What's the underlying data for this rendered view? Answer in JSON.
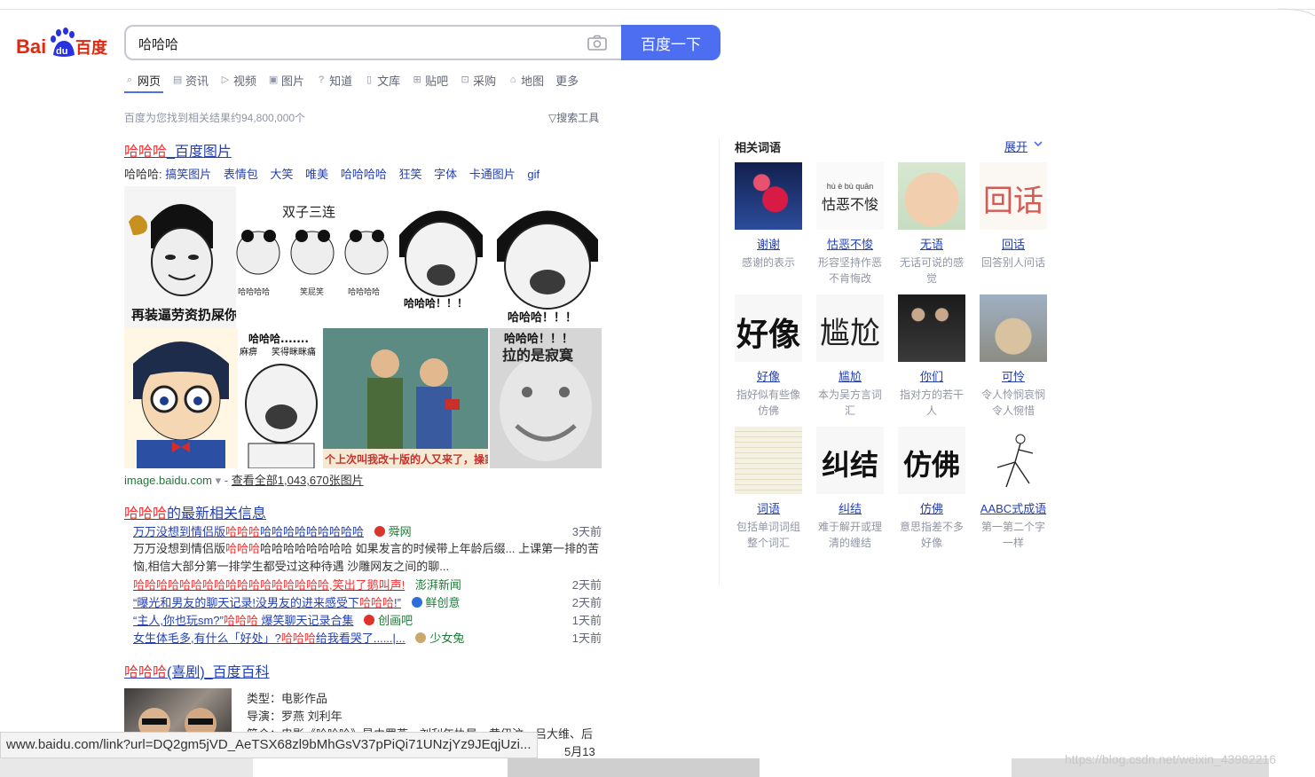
{
  "logo": {
    "text_bai": "Bai",
    "text_du": "du",
    "text_cn": "百度"
  },
  "search": {
    "value": "哈哈哈",
    "button": "百度一下"
  },
  "tabs": [
    {
      "label": "网页",
      "icon": "search-icon"
    },
    {
      "label": "资讯",
      "icon": "news-icon"
    },
    {
      "label": "视频",
      "icon": "video-icon"
    },
    {
      "label": "图片",
      "icon": "image-icon"
    },
    {
      "label": "知道",
      "icon": "question-icon"
    },
    {
      "label": "文库",
      "icon": "doc-icon"
    },
    {
      "label": "贴吧",
      "icon": "tieba-icon"
    },
    {
      "label": "采购",
      "icon": "cart-icon"
    },
    {
      "label": "地图",
      "icon": "map-icon"
    },
    {
      "label": "更多",
      "icon": ""
    }
  ],
  "result_count": "百度为您找到相关结果约94,800,000个",
  "search_tools": "搜索工具",
  "image_result": {
    "title_hl": "哈哈哈",
    "title_rest": "_百度图片",
    "tags_prefix": "哈哈哈:",
    "tags": [
      "搞笑图片",
      "表情包",
      "大笑",
      "唯美",
      "哈哈哈哈",
      "狂笑",
      "字体",
      "卡通图片",
      "gif"
    ],
    "images": [
      {
        "caption": "再装逼劳资扔屎你"
      },
      {
        "caption": "双子三连",
        "labels": [
          "哈哈哈哈",
          "笑屁笑",
          "哈哈哈哈"
        ]
      },
      {
        "caption": "哈哈哈！！！"
      },
      {
        "caption": "哈哈哈！！！"
      },
      {
        "caption": ""
      },
      {
        "caption": "哈哈哈.......",
        "sub1": "麻痹",
        "sub2": "笑得眯眯痛"
      },
      {
        "caption": "个上次叫我改十版的人又来了，操家"
      },
      {
        "caption": "拉的是寂寞"
      }
    ],
    "source": "image.baidu.com",
    "source_arrow": "▾",
    "dash": "-",
    "view_all": "查看全部1,043,670张图片"
  },
  "news_result": {
    "title_hl": "哈哈哈",
    "title_rest": "的最新相关信息",
    "items": [
      {
        "title_pre": "万万没想到情侣版",
        "title_hl": "哈哈哈",
        "title_post": "哈哈哈哈哈哈哈哈哈",
        "source": "舜网",
        "date": "3天前",
        "badge_color": "#d9362b"
      },
      {
        "title_pre": "",
        "title_hl": "哈哈哈",
        "title_post": "哈哈哈哈哈哈哈哈哈哈哈哈哈哈,笑出了鹅叫声!",
        "source": "澎湃新闻",
        "date": "2天前",
        "badge_color": ""
      },
      {
        "title_pre": "“曝光和男友的聊天记录!没男友的进来感受下",
        "title_hl": "哈哈哈",
        "title_post": "!”",
        "source": "鲜创意",
        "date": "2天前",
        "badge_color": "#2d6fd6"
      },
      {
        "title_pre": "“主人,你也玩sm?”",
        "title_hl": "哈哈哈",
        "title_post": " 爆笑聊天记录合集",
        "source": "创画吧",
        "date": "1天前",
        "badge_color": "#e0312a"
      },
      {
        "title_pre": "女生体毛多,有什么「好处」?",
        "title_hl": "哈哈哈",
        "title_post": "给我看哭了......|...",
        "source": "少女兔",
        "date": "1天前",
        "badge_color": "#c9a96b"
      }
    ],
    "abstract_1": "万万没想到情侣版",
    "abstract_hl": "哈哈哈",
    "abstract_2": "哈哈哈哈哈哈哈哈 如果发言的时候带上年龄后缀... 上课第一排的苦恼,相信大部分第一排学生都受过这种待遇 沙雕网友之间的聊..."
  },
  "baike_result": {
    "title_hl": "哈哈哈",
    "title_rest": "(喜剧)_百度百科",
    "type": "类型：电影作品",
    "director": "导演：罗燕 刘利年",
    "intro": "简介：电影《哈哈哈》是由罗燕、刘利年执导，黄伊汶、吕大维、后",
    "date_tail": "5月13"
  },
  "related": {
    "heading": "相关词语",
    "expand": "展开",
    "items": [
      {
        "name": "谢谢",
        "desc": "感谢的表示",
        "thumb_text": "",
        "thumb_kind": "flower"
      },
      {
        "name": "怙恶不悛",
        "desc": "形容坚持作恶不肯悔改",
        "thumb_text": "怙恶不悛",
        "thumb_pinyin": "hù è bù quān",
        "thumb_kind": "text"
      },
      {
        "name": "无语",
        "desc": "无话可说的感觉",
        "thumb_text": "",
        "thumb_kind": "baby"
      },
      {
        "name": "回话",
        "desc": "回答别人问话",
        "thumb_text": "回话",
        "thumb_kind": "redtext"
      },
      {
        "name": "好像",
        "desc": "指好似有些像仿佛",
        "thumb_text": "好像",
        "thumb_kind": "bold"
      },
      {
        "name": "尴尬",
        "desc": "本为吴方言词汇",
        "thumb_text": "尴尬",
        "thumb_kind": "thin"
      },
      {
        "name": "你们",
        "desc": "指对方的若干人",
        "thumb_text": "",
        "thumb_kind": "people"
      },
      {
        "name": "可怜",
        "desc": "令人怜悯哀悯令人惋惜",
        "thumb_text": "",
        "thumb_kind": "dog"
      },
      {
        "name": "词语",
        "desc": "包括单词词组整个词汇",
        "thumb_text": "",
        "thumb_kind": "table"
      },
      {
        "name": "纠结",
        "desc": "难于解开或理清的缠结",
        "thumb_text": "纠结",
        "thumb_kind": "brush"
      },
      {
        "name": "仿佛",
        "desc": "意思指差不多好像",
        "thumb_text": "仿佛",
        "thumb_kind": "brush"
      },
      {
        "name": "AABC式成语",
        "desc": "第一第二个字一样",
        "thumb_text": "",
        "thumb_kind": "sketch"
      }
    ]
  },
  "status_url": "www.baidu.com/link?url=DQ2gm5jVD_AeTSX68zl9bMhGsV37pPiQi71UNzjYz9JEqjUzi...",
  "watermark": "https://blog.csdn.net/weixin_43982216",
  "colors": {
    "brand_blue": "#4e6ef2",
    "link": "#2440b3",
    "highlight": "#f73131",
    "source_green": "#1e7a36"
  }
}
